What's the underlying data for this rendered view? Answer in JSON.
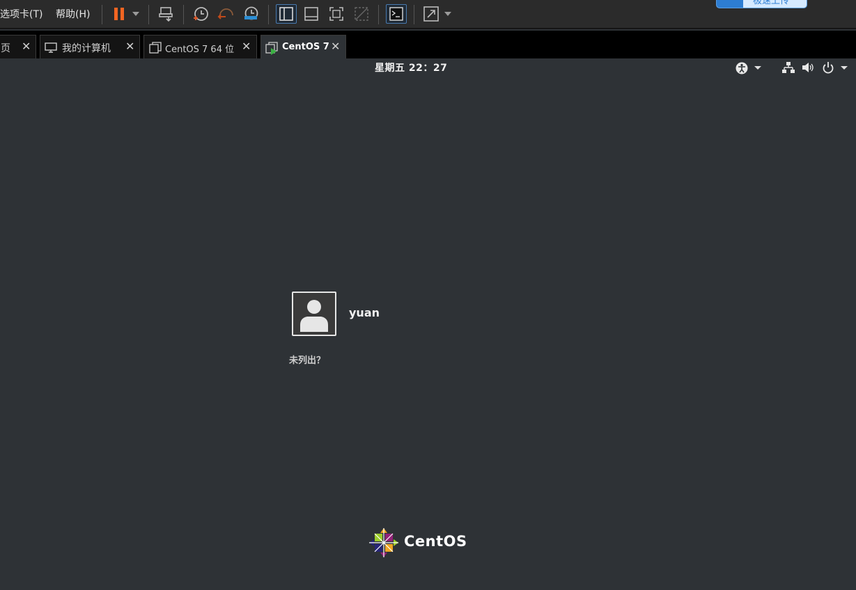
{
  "toolbar": {
    "menu_tabs": "选项卡(T)",
    "menu_help": "帮助(H)",
    "cloud_button_label": "极速上传",
    "icons": [
      "pause-icon",
      "send-keys-icon",
      "snapshot-icon",
      "revert-snapshot-icon",
      "snapshot-manager-icon",
      "library-view-icon",
      "thumbnail-view-icon",
      "full-screen-icon",
      "unity-icon",
      "console-icon",
      "stretch-icon"
    ],
    "accent_color": "#f26522"
  },
  "tabs": [
    {
      "label": "页",
      "active": false
    },
    {
      "label": "我的计算机",
      "active": false
    },
    {
      "label": "CentOS 7 64 位",
      "active": false
    },
    {
      "label": "CentOS 7",
      "active": true
    }
  ],
  "guest": {
    "clock": "星期五  22：27",
    "status_icons": [
      "accessibility-icon",
      "network-icon",
      "volume-icon",
      "power-icon"
    ],
    "user": {
      "name": "yuan"
    },
    "not_listed": "未列出？",
    "brand": "CentOS"
  }
}
